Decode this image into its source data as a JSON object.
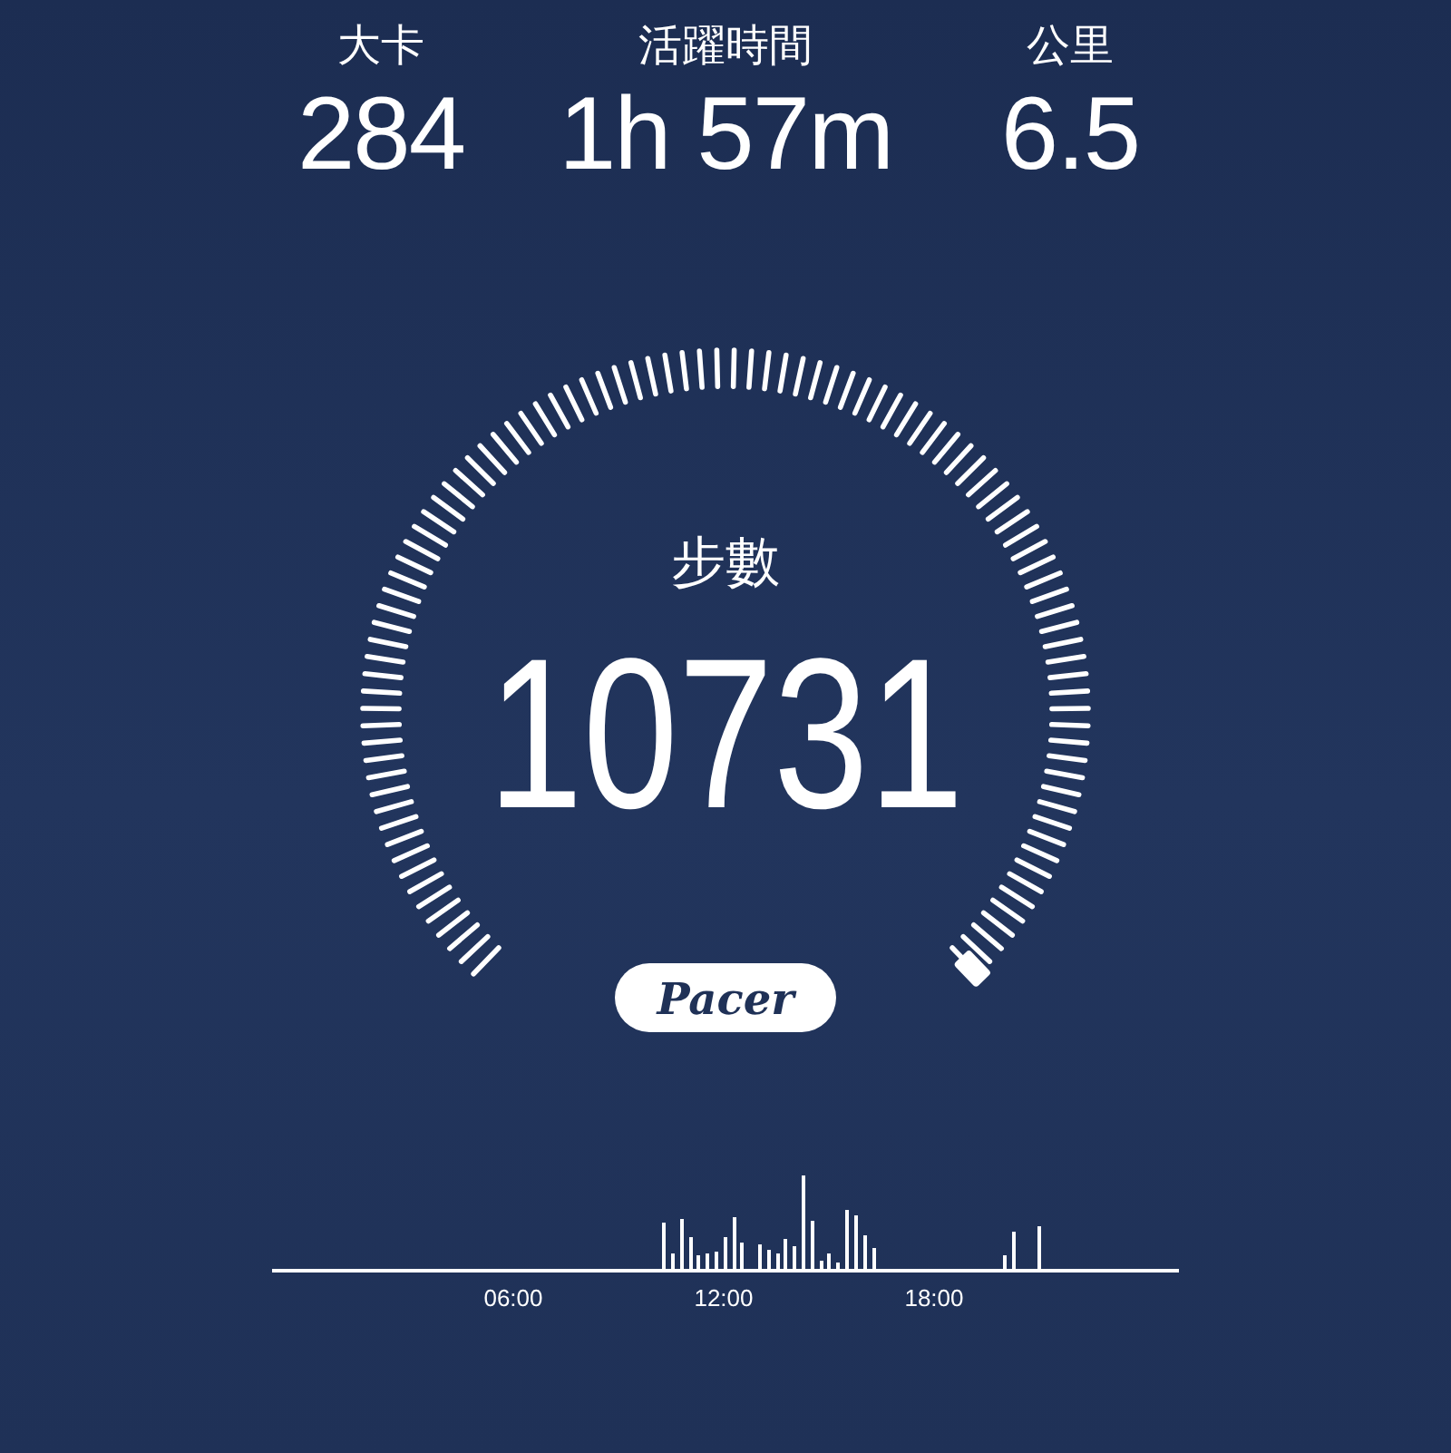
{
  "stats": [
    {
      "label": "大卡",
      "value": "284"
    },
    {
      "label": "活躍時間",
      "value": "1h 57m"
    },
    {
      "label": "公里",
      "value": "6.5"
    }
  ],
  "steps": {
    "label": "步數",
    "value": "10731"
  },
  "brand": "Pacer",
  "activity_chart": {
    "time_labels": [
      "06:00",
      "12:00",
      "18:00"
    ]
  }
}
